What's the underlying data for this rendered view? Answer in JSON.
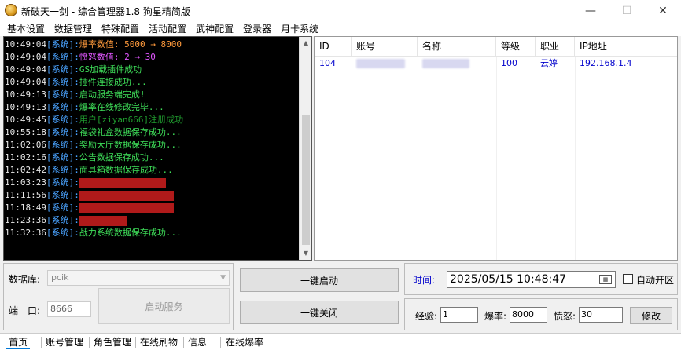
{
  "window": {
    "title": "新破天一剑 - 综合管理器1.8 狗星精简版",
    "min_glyph": "—",
    "max_glyph": "☐",
    "close_glyph": "✕"
  },
  "menu": [
    "基本设置",
    "数据管理",
    "特殊配置",
    "活动配置",
    "武神配置",
    "登录器",
    "月卡系统"
  ],
  "log": {
    "tag": "[系统]:",
    "lines": [
      {
        "time": "10:49:04",
        "msg": "爆率数值: 5000 → 8000",
        "color": "#ff9a3c"
      },
      {
        "time": "10:49:04",
        "msg": "愤怒数值: 2 → 30",
        "color": "#e257ff"
      },
      {
        "time": "10:49:04",
        "msg": "GS加载插件成功",
        "color": "#3fe05a"
      },
      {
        "time": "10:49:04",
        "msg": "插件连接成功...",
        "color": "#3fe05a"
      },
      {
        "time": "10:49:13",
        "msg": "启动服务端完成!",
        "color": "#3fe05a"
      },
      {
        "time": "10:49:13",
        "msg": "爆率在线修改完毕...",
        "color": "#3fe05a"
      },
      {
        "time": "10:49:45",
        "msg": "用户[ziyan666]注册成功",
        "color": "#1f9a2e"
      },
      {
        "time": "10:55:18",
        "msg": "福袋礼盒数据保存成功...",
        "color": "#3fe05a"
      },
      {
        "time": "11:02:06",
        "msg": "奖励大厅数据保存成功...",
        "color": "#3fe05a"
      },
      {
        "time": "11:02:16",
        "msg": "公告数据保存成功...",
        "color": "#3fe05a"
      },
      {
        "time": "11:02:42",
        "msg": "面具箱数据保存成功...",
        "color": "#3fe05a"
      },
      {
        "time": "11:03:23",
        "msg": "",
        "color": "#ff3030"
      },
      {
        "time": "11:11:56",
        "msg": "",
        "color": "#ff3030"
      },
      {
        "time": "11:18:49",
        "msg": "",
        "color": "#ff3030"
      },
      {
        "time": "11:23:36",
        "msg": "",
        "color": "#ff3030"
      },
      {
        "time": "11:32:36",
        "msg": "战力系统数据保存成功...",
        "color": "#3fe05a"
      }
    ]
  },
  "players_table": {
    "columns": [
      "ID",
      "账号",
      "名称",
      "等级",
      "职业",
      "IP地址"
    ],
    "rows": [
      {
        "id": "104",
        "account": "",
        "name": "",
        "level": "100",
        "job": "云婷",
        "ip": "192.168.1.4"
      }
    ]
  },
  "server": {
    "db_label": "数据库:",
    "db_value": "pcik",
    "port_label": "端　口:",
    "port_value": "8666",
    "start_service": "启动服务"
  },
  "actions": {
    "one_key_start": "一键启动",
    "one_key_close": "一键关闭"
  },
  "settings": {
    "time_label": "时间:",
    "datetime": "2025/05/15 10:48:47",
    "auto_open_label": "自动开区",
    "exp_label": "经验:",
    "exp_value": "1",
    "drop_label": "爆率:",
    "drop_value": "8000",
    "rage_label": "愤怒:",
    "rage_value": "30",
    "modify_button": "修改"
  },
  "tabs": [
    "首页",
    "账号管理",
    "角色管理",
    "在线刷物",
    "信息",
    "在线爆率"
  ],
  "colors": {
    "log_bg": "#000000",
    "system_tag": "#4aa3ff",
    "table_text": "#0000cc"
  }
}
